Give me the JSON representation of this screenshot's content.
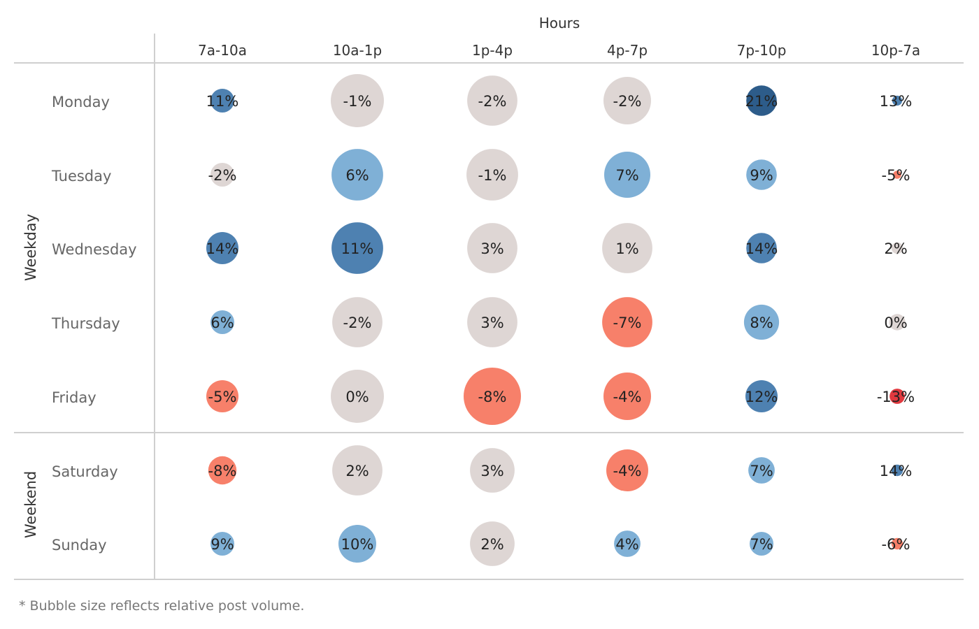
{
  "chart_data": {
    "type": "bubble-table",
    "title": "Hours",
    "columns": [
      "7a-10a",
      "10a-1p",
      "1p-4p",
      "4p-7p",
      "7p-10p",
      "10p-7a"
    ],
    "groups": [
      {
        "label": "Weekday",
        "rows": [
          "Monday",
          "Tuesday",
          "Wednesday",
          "Thursday",
          "Friday"
        ]
      },
      {
        "label": "Weekend",
        "rows": [
          "Saturday",
          "Sunday"
        ]
      }
    ],
    "rows": [
      "Monday",
      "Tuesday",
      "Wednesday",
      "Thursday",
      "Friday",
      "Saturday",
      "Sunday"
    ],
    "values": [
      [
        11,
        -1,
        -2,
        -2,
        21,
        13
      ],
      [
        -2,
        6,
        -1,
        7,
        9,
        -5
      ],
      [
        14,
        11,
        3,
        1,
        14,
        2
      ],
      [
        6,
        -2,
        3,
        -7,
        8,
        0
      ],
      [
        -5,
        0,
        -8,
        -4,
        12,
        -13
      ],
      [
        -8,
        2,
        3,
        -4,
        7,
        14
      ],
      [
        9,
        10,
        2,
        4,
        7,
        -6
      ]
    ],
    "relative_volume": [
      [
        17,
        85,
        76,
        68,
        28,
        3
      ],
      [
        17,
        80,
        80,
        64,
        28,
        2
      ],
      [
        31,
        80,
        76,
        76,
        28,
        4
      ],
      [
        17,
        76,
        76,
        76,
        37,
        8
      ],
      [
        31,
        85,
        99,
        68,
        31,
        7
      ],
      [
        24,
        76,
        60,
        53,
        21,
        4
      ],
      [
        17,
        43,
        60,
        21,
        17,
        4
      ]
    ],
    "value_format": "percent",
    "colors": {
      "strong_positive": "#2d5c8a",
      "positive": "#4e81b1",
      "mild_positive": "#7fb0d6",
      "neutral": "#ded6d4",
      "negative": "#f7806a",
      "strong_negative": "#e0393f"
    },
    "footnote": "* Bubble size reflects relative post volume."
  }
}
